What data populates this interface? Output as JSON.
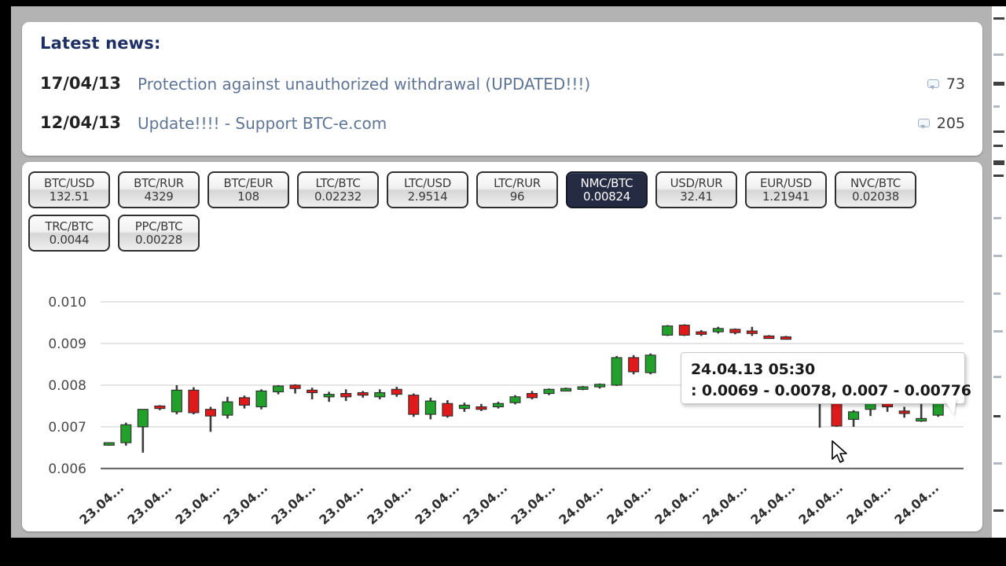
{
  "news": {
    "title": "Latest news:",
    "items": [
      {
        "date": "17/04/13",
        "link": "Protection against unauthorized withdrawal (UPDATED!!!)",
        "comments": "73",
        "comment_icon": "comment-bubble-icon"
      },
      {
        "date": "12/04/13",
        "link": "Update!!!! - Support BTC-e.com",
        "comments": "205",
        "comment_icon": "comment-bubble-icon"
      }
    ]
  },
  "ticker": {
    "active_pair": "NMC/BTC",
    "active_color": "#242b42",
    "pairs": [
      {
        "name": "BTC/USD",
        "value": "132.51",
        "active": false
      },
      {
        "name": "BTC/RUR",
        "value": "4329",
        "active": false
      },
      {
        "name": "BTC/EUR",
        "value": "108",
        "active": false
      },
      {
        "name": "LTC/BTC",
        "value": "0.02232",
        "active": false
      },
      {
        "name": "LTC/USD",
        "value": "2.9514",
        "active": false
      },
      {
        "name": "LTC/RUR",
        "value": "96",
        "active": false
      },
      {
        "name": "NMC/BTC",
        "value": "0.00824",
        "active": true
      },
      {
        "name": "USD/RUR",
        "value": "32.41",
        "active": false
      },
      {
        "name": "EUR/USD",
        "value": "1.21941",
        "active": false
      },
      {
        "name": "NVC/BTC",
        "value": "0.02038",
        "active": false
      },
      {
        "name": "TRC/BTC",
        "value": "0.0044",
        "active": false
      },
      {
        "name": "PPC/BTC",
        "value": "0.00228",
        "active": false
      }
    ]
  },
  "tooltip": {
    "datetime": "24.04.13 05:30",
    "values": ": 0.0069 - 0.0078, 0.007 - 0.00776"
  },
  "chart_data": {
    "type": "candlestick",
    "title": "",
    "xlabel": "",
    "ylabel": "",
    "ylim": [
      0.006,
      0.0103
    ],
    "yticks": [
      "0.010",
      "0.009",
      "0.008",
      "0.007",
      "0.006"
    ],
    "ytick_values": [
      0.01,
      0.009,
      0.008,
      0.007,
      0.006
    ],
    "grid": true,
    "legend": "none",
    "up_color": "#22a02c",
    "down_color": "#e0191b",
    "wick_color": "#3c3c3c",
    "xtick_labels": [
      "23.04...",
      "23.04...",
      "23.04...",
      "23.04...",
      "23.04...",
      "23.04...",
      "23.04...",
      "23.04...",
      "23.04...",
      "23.04...",
      "24.04...",
      "24.04...",
      "24.04...",
      "24.04...",
      "24.04...",
      "24.04...",
      "24.04...",
      "24.04..."
    ],
    "candles": [
      {
        "o": 0.00658,
        "h": 0.00662,
        "l": 0.00655,
        "c": 0.00662,
        "dir": "up"
      },
      {
        "o": 0.00662,
        "h": 0.0071,
        "l": 0.00655,
        "c": 0.00705,
        "dir": "up"
      },
      {
        "o": 0.007,
        "h": 0.00742,
        "l": 0.00638,
        "c": 0.00742,
        "dir": "up"
      },
      {
        "o": 0.0075,
        "h": 0.00752,
        "l": 0.0074,
        "c": 0.00744,
        "dir": "down"
      },
      {
        "o": 0.00736,
        "h": 0.008,
        "l": 0.0073,
        "c": 0.00788,
        "dir": "up"
      },
      {
        "o": 0.00788,
        "h": 0.00795,
        "l": 0.0073,
        "c": 0.00734,
        "dir": "down"
      },
      {
        "o": 0.00742,
        "h": 0.00748,
        "l": 0.00688,
        "c": 0.00726,
        "dir": "down"
      },
      {
        "o": 0.00728,
        "h": 0.00772,
        "l": 0.0072,
        "c": 0.0076,
        "dir": "up"
      },
      {
        "o": 0.00752,
        "h": 0.00775,
        "l": 0.00744,
        "c": 0.0077,
        "dir": "down"
      },
      {
        "o": 0.00748,
        "h": 0.0079,
        "l": 0.00742,
        "c": 0.00786,
        "dir": "up"
      },
      {
        "o": 0.00784,
        "h": 0.008,
        "l": 0.00778,
        "c": 0.00798,
        "dir": "up"
      },
      {
        "o": 0.008,
        "h": 0.00802,
        "l": 0.0078,
        "c": 0.00792,
        "dir": "down"
      },
      {
        "o": 0.00788,
        "h": 0.00794,
        "l": 0.00766,
        "c": 0.00784,
        "dir": "down"
      },
      {
        "o": 0.00772,
        "h": 0.00784,
        "l": 0.0076,
        "c": 0.00778,
        "dir": "up"
      },
      {
        "o": 0.0078,
        "h": 0.0079,
        "l": 0.00762,
        "c": 0.00772,
        "dir": "down"
      },
      {
        "o": 0.00776,
        "h": 0.00786,
        "l": 0.0077,
        "c": 0.00782,
        "dir": "down"
      },
      {
        "o": 0.00782,
        "h": 0.0079,
        "l": 0.00766,
        "c": 0.00772,
        "dir": "up"
      },
      {
        "o": 0.0079,
        "h": 0.00796,
        "l": 0.00772,
        "c": 0.00778,
        "dir": "down"
      },
      {
        "o": 0.00776,
        "h": 0.0078,
        "l": 0.00724,
        "c": 0.0073,
        "dir": "down"
      },
      {
        "o": 0.00762,
        "h": 0.0077,
        "l": 0.00718,
        "c": 0.0073,
        "dir": "up"
      },
      {
        "o": 0.00756,
        "h": 0.00764,
        "l": 0.00722,
        "c": 0.00726,
        "dir": "down"
      },
      {
        "o": 0.00752,
        "h": 0.00758,
        "l": 0.00736,
        "c": 0.00744,
        "dir": "up"
      },
      {
        "o": 0.00748,
        "h": 0.00755,
        "l": 0.00738,
        "c": 0.00748,
        "dir": "down"
      },
      {
        "o": 0.00748,
        "h": 0.0076,
        "l": 0.00744,
        "c": 0.00756,
        "dir": "up"
      },
      {
        "o": 0.00758,
        "h": 0.00776,
        "l": 0.00754,
        "c": 0.00772,
        "dir": "up"
      },
      {
        "o": 0.0077,
        "h": 0.00786,
        "l": 0.00766,
        "c": 0.0078,
        "dir": "down"
      },
      {
        "o": 0.0078,
        "h": 0.00792,
        "l": 0.00776,
        "c": 0.0079,
        "dir": "up"
      },
      {
        "o": 0.0079,
        "h": 0.00794,
        "l": 0.00786,
        "c": 0.00792,
        "dir": "up"
      },
      {
        "o": 0.00792,
        "h": 0.00798,
        "l": 0.00788,
        "c": 0.00796,
        "dir": "up"
      },
      {
        "o": 0.00796,
        "h": 0.00804,
        "l": 0.00792,
        "c": 0.00802,
        "dir": "up"
      },
      {
        "o": 0.008,
        "h": 0.0087,
        "l": 0.00798,
        "c": 0.00866,
        "dir": "up"
      },
      {
        "o": 0.00866,
        "h": 0.00872,
        "l": 0.00826,
        "c": 0.00832,
        "dir": "down"
      },
      {
        "o": 0.0083,
        "h": 0.00876,
        "l": 0.00826,
        "c": 0.00872,
        "dir": "up"
      },
      {
        "o": 0.0092,
        "h": 0.00944,
        "l": 0.00918,
        "c": 0.00942,
        "dir": "up"
      },
      {
        "o": 0.00944,
        "h": 0.00946,
        "l": 0.00918,
        "c": 0.0092,
        "dir": "down"
      },
      {
        "o": 0.00928,
        "h": 0.00932,
        "l": 0.00918,
        "c": 0.00922,
        "dir": "down"
      },
      {
        "o": 0.00928,
        "h": 0.0094,
        "l": 0.00924,
        "c": 0.00936,
        "dir": "up"
      },
      {
        "o": 0.00934,
        "h": 0.00936,
        "l": 0.00922,
        "c": 0.00926,
        "dir": "down"
      },
      {
        "o": 0.0093,
        "h": 0.0094,
        "l": 0.00918,
        "c": 0.00924,
        "dir": "down"
      },
      {
        "o": 0.00918,
        "h": 0.0092,
        "l": 0.00914,
        "c": 0.00916,
        "dir": "down"
      },
      {
        "o": 0.00916,
        "h": 0.00918,
        "l": 0.00912,
        "c": 0.00914,
        "dir": "down"
      },
      {
        "o": 0.008,
        "h": 0.00802,
        "l": 0.0078,
        "c": 0.00784,
        "dir": "down"
      },
      {
        "o": 0.00786,
        "h": 0.00794,
        "l": 0.00698,
        "c": 0.00782,
        "dir": "down"
      },
      {
        "o": 0.0078,
        "h": 0.00786,
        "l": 0.007,
        "c": 0.00702,
        "dir": "down"
      },
      {
        "o": 0.00718,
        "h": 0.0074,
        "l": 0.007,
        "c": 0.00736,
        "dir": "up"
      },
      {
        "o": 0.00742,
        "h": 0.00766,
        "l": 0.00726,
        "c": 0.00756,
        "dir": "up"
      },
      {
        "o": 0.00764,
        "h": 0.008,
        "l": 0.00736,
        "c": 0.00748,
        "dir": "down"
      },
      {
        "o": 0.00738,
        "h": 0.00748,
        "l": 0.00722,
        "c": 0.00732,
        "dir": "down"
      },
      {
        "o": 0.0072,
        "h": 0.00768,
        "l": 0.00712,
        "c": 0.00718,
        "dir": "up"
      },
      {
        "o": 0.00728,
        "h": 0.008,
        "l": 0.00724,
        "c": 0.00796,
        "dir": "up"
      },
      {
        "o": 0.00798,
        "h": 0.00812,
        "l": 0.00792,
        "c": 0.00808,
        "dir": "up"
      }
    ]
  }
}
